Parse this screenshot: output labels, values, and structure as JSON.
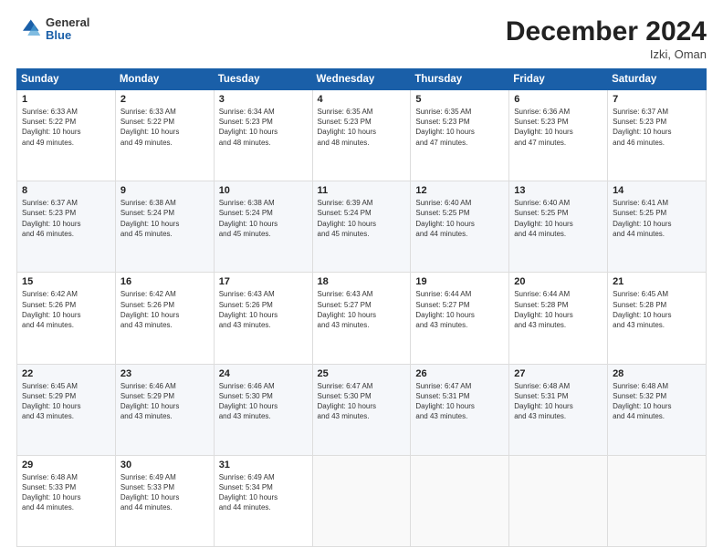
{
  "logo": {
    "general": "General",
    "blue": "Blue"
  },
  "header": {
    "title": "December 2024",
    "location": "Izki, Oman"
  },
  "weekdays": [
    "Sunday",
    "Monday",
    "Tuesday",
    "Wednesday",
    "Thursday",
    "Friday",
    "Saturday"
  ],
  "weeks": [
    [
      {
        "day": "1",
        "info": "Sunrise: 6:33 AM\nSunset: 5:22 PM\nDaylight: 10 hours\nand 49 minutes."
      },
      {
        "day": "2",
        "info": "Sunrise: 6:33 AM\nSunset: 5:22 PM\nDaylight: 10 hours\nand 49 minutes."
      },
      {
        "day": "3",
        "info": "Sunrise: 6:34 AM\nSunset: 5:23 PM\nDaylight: 10 hours\nand 48 minutes."
      },
      {
        "day": "4",
        "info": "Sunrise: 6:35 AM\nSunset: 5:23 PM\nDaylight: 10 hours\nand 48 minutes."
      },
      {
        "day": "5",
        "info": "Sunrise: 6:35 AM\nSunset: 5:23 PM\nDaylight: 10 hours\nand 47 minutes."
      },
      {
        "day": "6",
        "info": "Sunrise: 6:36 AM\nSunset: 5:23 PM\nDaylight: 10 hours\nand 47 minutes."
      },
      {
        "day": "7",
        "info": "Sunrise: 6:37 AM\nSunset: 5:23 PM\nDaylight: 10 hours\nand 46 minutes."
      }
    ],
    [
      {
        "day": "8",
        "info": "Sunrise: 6:37 AM\nSunset: 5:23 PM\nDaylight: 10 hours\nand 46 minutes."
      },
      {
        "day": "9",
        "info": "Sunrise: 6:38 AM\nSunset: 5:24 PM\nDaylight: 10 hours\nand 45 minutes."
      },
      {
        "day": "10",
        "info": "Sunrise: 6:38 AM\nSunset: 5:24 PM\nDaylight: 10 hours\nand 45 minutes."
      },
      {
        "day": "11",
        "info": "Sunrise: 6:39 AM\nSunset: 5:24 PM\nDaylight: 10 hours\nand 45 minutes."
      },
      {
        "day": "12",
        "info": "Sunrise: 6:40 AM\nSunset: 5:25 PM\nDaylight: 10 hours\nand 44 minutes."
      },
      {
        "day": "13",
        "info": "Sunrise: 6:40 AM\nSunset: 5:25 PM\nDaylight: 10 hours\nand 44 minutes."
      },
      {
        "day": "14",
        "info": "Sunrise: 6:41 AM\nSunset: 5:25 PM\nDaylight: 10 hours\nand 44 minutes."
      }
    ],
    [
      {
        "day": "15",
        "info": "Sunrise: 6:42 AM\nSunset: 5:26 PM\nDaylight: 10 hours\nand 44 minutes."
      },
      {
        "day": "16",
        "info": "Sunrise: 6:42 AM\nSunset: 5:26 PM\nDaylight: 10 hours\nand 43 minutes."
      },
      {
        "day": "17",
        "info": "Sunrise: 6:43 AM\nSunset: 5:26 PM\nDaylight: 10 hours\nand 43 minutes."
      },
      {
        "day": "18",
        "info": "Sunrise: 6:43 AM\nSunset: 5:27 PM\nDaylight: 10 hours\nand 43 minutes."
      },
      {
        "day": "19",
        "info": "Sunrise: 6:44 AM\nSunset: 5:27 PM\nDaylight: 10 hours\nand 43 minutes."
      },
      {
        "day": "20",
        "info": "Sunrise: 6:44 AM\nSunset: 5:28 PM\nDaylight: 10 hours\nand 43 minutes."
      },
      {
        "day": "21",
        "info": "Sunrise: 6:45 AM\nSunset: 5:28 PM\nDaylight: 10 hours\nand 43 minutes."
      }
    ],
    [
      {
        "day": "22",
        "info": "Sunrise: 6:45 AM\nSunset: 5:29 PM\nDaylight: 10 hours\nand 43 minutes."
      },
      {
        "day": "23",
        "info": "Sunrise: 6:46 AM\nSunset: 5:29 PM\nDaylight: 10 hours\nand 43 minutes."
      },
      {
        "day": "24",
        "info": "Sunrise: 6:46 AM\nSunset: 5:30 PM\nDaylight: 10 hours\nand 43 minutes."
      },
      {
        "day": "25",
        "info": "Sunrise: 6:47 AM\nSunset: 5:30 PM\nDaylight: 10 hours\nand 43 minutes."
      },
      {
        "day": "26",
        "info": "Sunrise: 6:47 AM\nSunset: 5:31 PM\nDaylight: 10 hours\nand 43 minutes."
      },
      {
        "day": "27",
        "info": "Sunrise: 6:48 AM\nSunset: 5:31 PM\nDaylight: 10 hours\nand 43 minutes."
      },
      {
        "day": "28",
        "info": "Sunrise: 6:48 AM\nSunset: 5:32 PM\nDaylight: 10 hours\nand 44 minutes."
      }
    ],
    [
      {
        "day": "29",
        "info": "Sunrise: 6:48 AM\nSunset: 5:33 PM\nDaylight: 10 hours\nand 44 minutes."
      },
      {
        "day": "30",
        "info": "Sunrise: 6:49 AM\nSunset: 5:33 PM\nDaylight: 10 hours\nand 44 minutes."
      },
      {
        "day": "31",
        "info": "Sunrise: 6:49 AM\nSunset: 5:34 PM\nDaylight: 10 hours\nand 44 minutes."
      },
      null,
      null,
      null,
      null
    ]
  ]
}
